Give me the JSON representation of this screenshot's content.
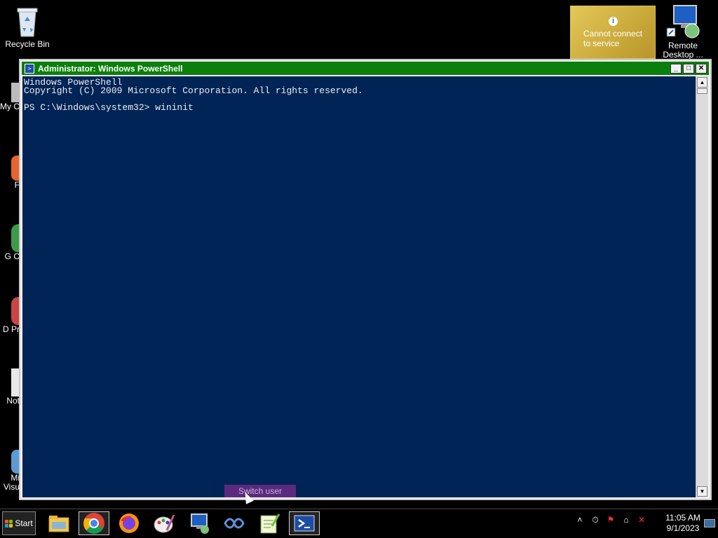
{
  "desktop": {
    "icons": [
      {
        "label": "Recycle Bin"
      },
      {
        "label": "Remote Desktop ..."
      }
    ],
    "partial_labels": [
      "My C",
      "F",
      "G C",
      "D Pr",
      "Not",
      "Mi Visu"
    ]
  },
  "notification": {
    "text_line1": "Cannot connect",
    "text_line2": "to service",
    "icon": "info-icon"
  },
  "window": {
    "title": "Administrator: Windows PowerShell",
    "buttons": {
      "minimize": "_",
      "maximize": "□",
      "close": "✕"
    },
    "console_text": "Windows PowerShell\nCopyright (C) 2009 Microsoft Corporation. All rights reserved.\n\nPS C:\\Windows\\system32> wininit",
    "colors": {
      "console_bg": "#012456",
      "titlebar": "#0b7f0b"
    }
  },
  "switch_user": {
    "label": "Switch user"
  },
  "taskbar": {
    "start_label": "Start",
    "apps": [
      {
        "name": "file-explorer-icon"
      },
      {
        "name": "chrome-icon"
      },
      {
        "name": "firefox-icon"
      },
      {
        "name": "paint-icon"
      },
      {
        "name": "remote-desktop-icon"
      },
      {
        "name": "visual-studio-icon"
      },
      {
        "name": "notepad-plus-icon"
      },
      {
        "name": "powershell-icon"
      }
    ],
    "clock": {
      "time": "11:05 AM",
      "date": "9/1/2023"
    }
  }
}
